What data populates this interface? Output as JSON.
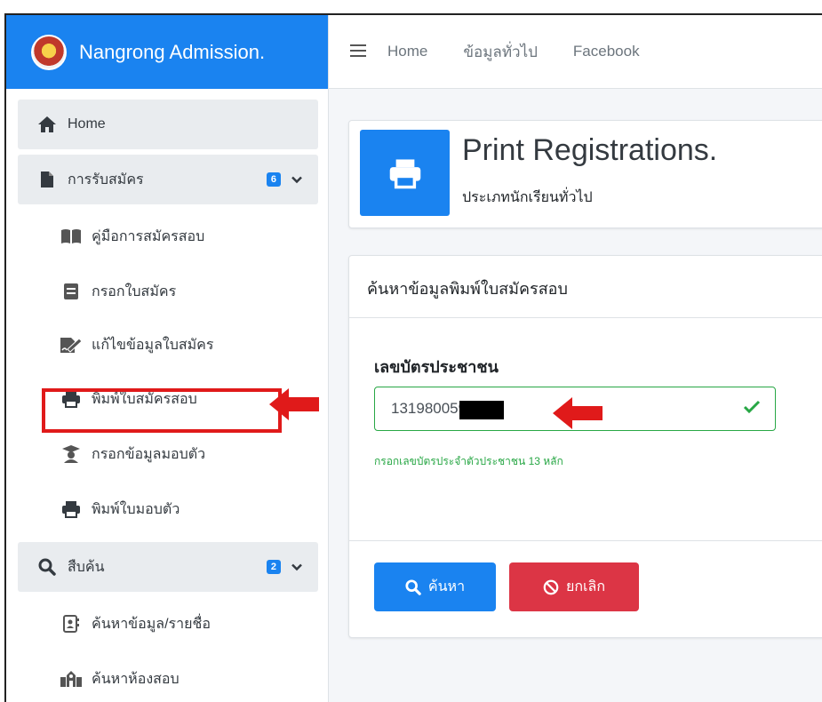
{
  "brand": {
    "name": "Nangrong Admission."
  },
  "topnav": {
    "links": [
      "Home",
      "ข้อมูลทั่วไป",
      "Facebook"
    ]
  },
  "sidebar": {
    "items": [
      {
        "label": "Home",
        "icon": "home-icon"
      },
      {
        "label": "การรับสมัคร",
        "icon": "file-icon",
        "badge": "6"
      },
      {
        "label": "คู่มือการสมัครสอบ",
        "icon": "book-icon"
      },
      {
        "label": "กรอกใบสมัคร",
        "icon": "form-icon"
      },
      {
        "label": "แก้ไขข้อมูลใบสมัคร",
        "icon": "signature-icon"
      },
      {
        "label": "พิมพ์ใบสมัครสอบ",
        "icon": "print-icon"
      },
      {
        "label": "กรอกข้อมูลมอบตัว",
        "icon": "graduate-icon"
      },
      {
        "label": "พิมพ์ใบมอบตัว",
        "icon": "print-icon"
      },
      {
        "label": "สืบค้น",
        "icon": "search-icon",
        "badge": "2"
      },
      {
        "label": "ค้นหาข้อมูล/รายชื่อ",
        "icon": "contact-card-icon"
      },
      {
        "label": "ค้นหาห้องสอบ",
        "icon": "school-icon"
      }
    ]
  },
  "header": {
    "title": "Print Registrations.",
    "subtitle": "ประเภทนักเรียนทั่วไป"
  },
  "form": {
    "section_title": "ค้นหาข้อมูลพิมพ์ใบสมัครสอบ",
    "field_label": "เลขบัตรประชาชน",
    "id_value": "131980059",
    "help_text": "กรอกเลขบัตรประจำตัวประชาชน 13 หลัก",
    "search_label": "ค้นหา",
    "cancel_label": "ยกเลิก"
  },
  "colors": {
    "primary": "#1a83f0",
    "danger": "#dc3545",
    "success": "#28a745",
    "annotation": "#e01a1a"
  }
}
